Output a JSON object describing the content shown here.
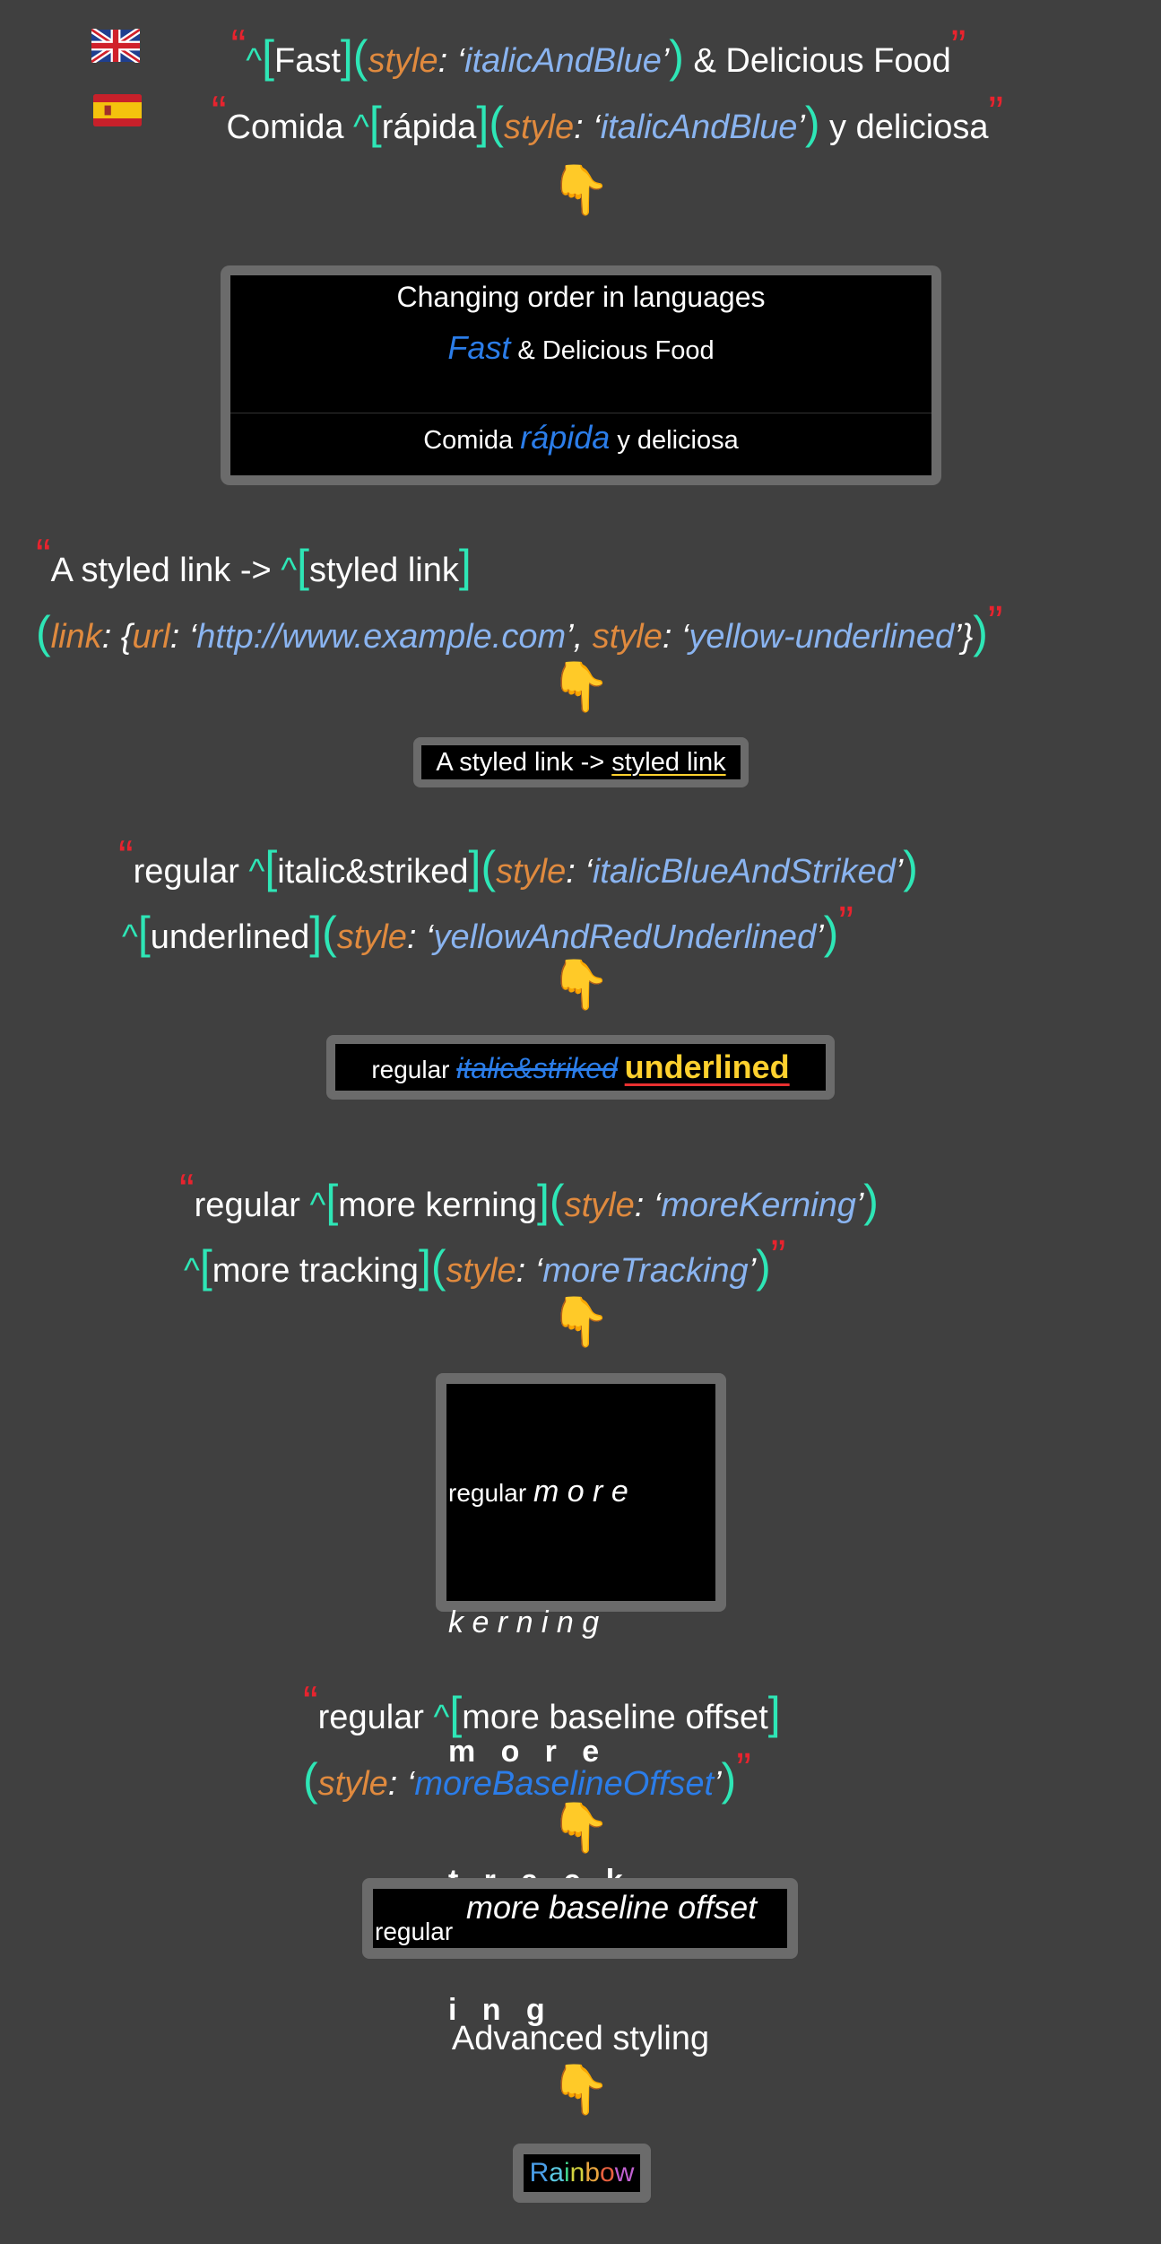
{
  "colors": {
    "background": "#404040",
    "quote": "#e8232e",
    "bracket": "#2ee6b6",
    "key": "#e08a3e",
    "value": "#8ab4f0",
    "blue": "#2b7de9",
    "yellow": "#ffd12e"
  },
  "section1": {
    "en_open": "“",
    "en_caret": "^",
    "en_lb": "[",
    "en_word": "Fast",
    "en_rb": "]",
    "en_lp": "(",
    "en_key": "style",
    "en_colon": ": ‘",
    "en_val": "italicAndBlue",
    "en_close": "’",
    "en_rp": ")",
    "en_rest": " & Delicious Food",
    "en_end": "”",
    "es_open": "“",
    "es_pre": "Comida ",
    "es_caret": "^",
    "es_lb": "[",
    "es_word": "rápida",
    "es_rb": "]",
    "es_lp": "(",
    "es_key": "style",
    "es_colon": ": ‘",
    "es_val": "italicAndBlue",
    "es_close": "’",
    "es_rp": ")",
    "es_rest": " y deliciosa",
    "es_end": "”",
    "hand": "👇",
    "box_title": "Changing order in languages",
    "box_fast": "Fast",
    "box_fast_rest": " & Delicious Food",
    "box_comida": "Comida ",
    "box_rapida": "rápida",
    "box_rapida_rest": " y deliciosa"
  },
  "section2": {
    "open": "“",
    "pre": "A styled link -> ",
    "caret": "^",
    "lb": "[",
    "word": "styled link",
    "rb": "]",
    "lp": "(",
    "k1": "link",
    "s1": ": {",
    "k2": "url",
    "s2": ": ‘",
    "url": "http://www.example.com",
    "s3": "’, ",
    "k3": "style",
    "s4": ": ‘",
    "v3": "yellow-underlined",
    "s5": "’}",
    "rp": ")",
    "end": "”",
    "hand": "👇",
    "result_pre": "A styled link -> ",
    "result_link": "styled link"
  },
  "section3": {
    "open": "“",
    "pre": "regular ",
    "caret": "^",
    "lb": "[",
    "word1": "italic&striked",
    "rb": "]",
    "lp": "(",
    "key1": "style",
    "colon1": ": ‘",
    "val1": "italicBlueAndStriked",
    "close1": "’",
    "rp": ")",
    "caret2": "^",
    "lb2": "[",
    "word2": "underlined",
    "rb2": "]",
    "lp2": "(",
    "key2": "style",
    "colon2": ": ‘",
    "val2": "yellowAndRedUnderlined",
    "close2": "’",
    "rp2": ")",
    "end": "”",
    "hand": "👇",
    "r_regular": "regular ",
    "r_italic": "italic&striked",
    "r_under": "underlined"
  },
  "section4": {
    "open": "“",
    "pre": "regular ",
    "caret": "^",
    "lb": "[",
    "word1": "more kerning",
    "rb": "]",
    "lp": "(",
    "key1": "style",
    "colon1": ": ‘",
    "val1": "moreKerning",
    "close1": "’",
    "rp": ")",
    "caret2": "^",
    "lb2": "[",
    "word2": "more tracking",
    "rb2": "]",
    "lp2": "(",
    "key2": "style",
    "colon2": ": ‘",
    "val2": "moreTracking",
    "close2": "’",
    "rp2": ")",
    "end": "”",
    "hand": "👇",
    "r_regular": "regular ",
    "r_l1": "m o r e",
    "r_l2": "k e r n i n g",
    "r_l3": "m   o   r   e",
    "r_l4": "t   r   a   c   k",
    "r_l5": "i   n   g"
  },
  "section5": {
    "open": "“",
    "pre": "regular ",
    "caret": "^",
    "lb": "[",
    "word": "more baseline offset",
    "rb": "]",
    "lp": "(",
    "key": "style",
    "colon": ": ‘",
    "val": "moreBaselineOffset",
    "close": "’",
    "rp": ")",
    "end": "”",
    "hand": "👇",
    "r_regular": "regular",
    "r_offset": "more baseline offset"
  },
  "section6": {
    "title": "Advanced styling",
    "hand": "👇",
    "rainbow": [
      "R",
      "a",
      "i",
      "n",
      "b",
      "o",
      "w"
    ],
    "rainbow_colors": [
      "#4a9ee8",
      "#5ac8e0",
      "#3fd28a",
      "#d2d23f",
      "#e8a53f",
      "#e8603f",
      "#c060d0"
    ]
  }
}
